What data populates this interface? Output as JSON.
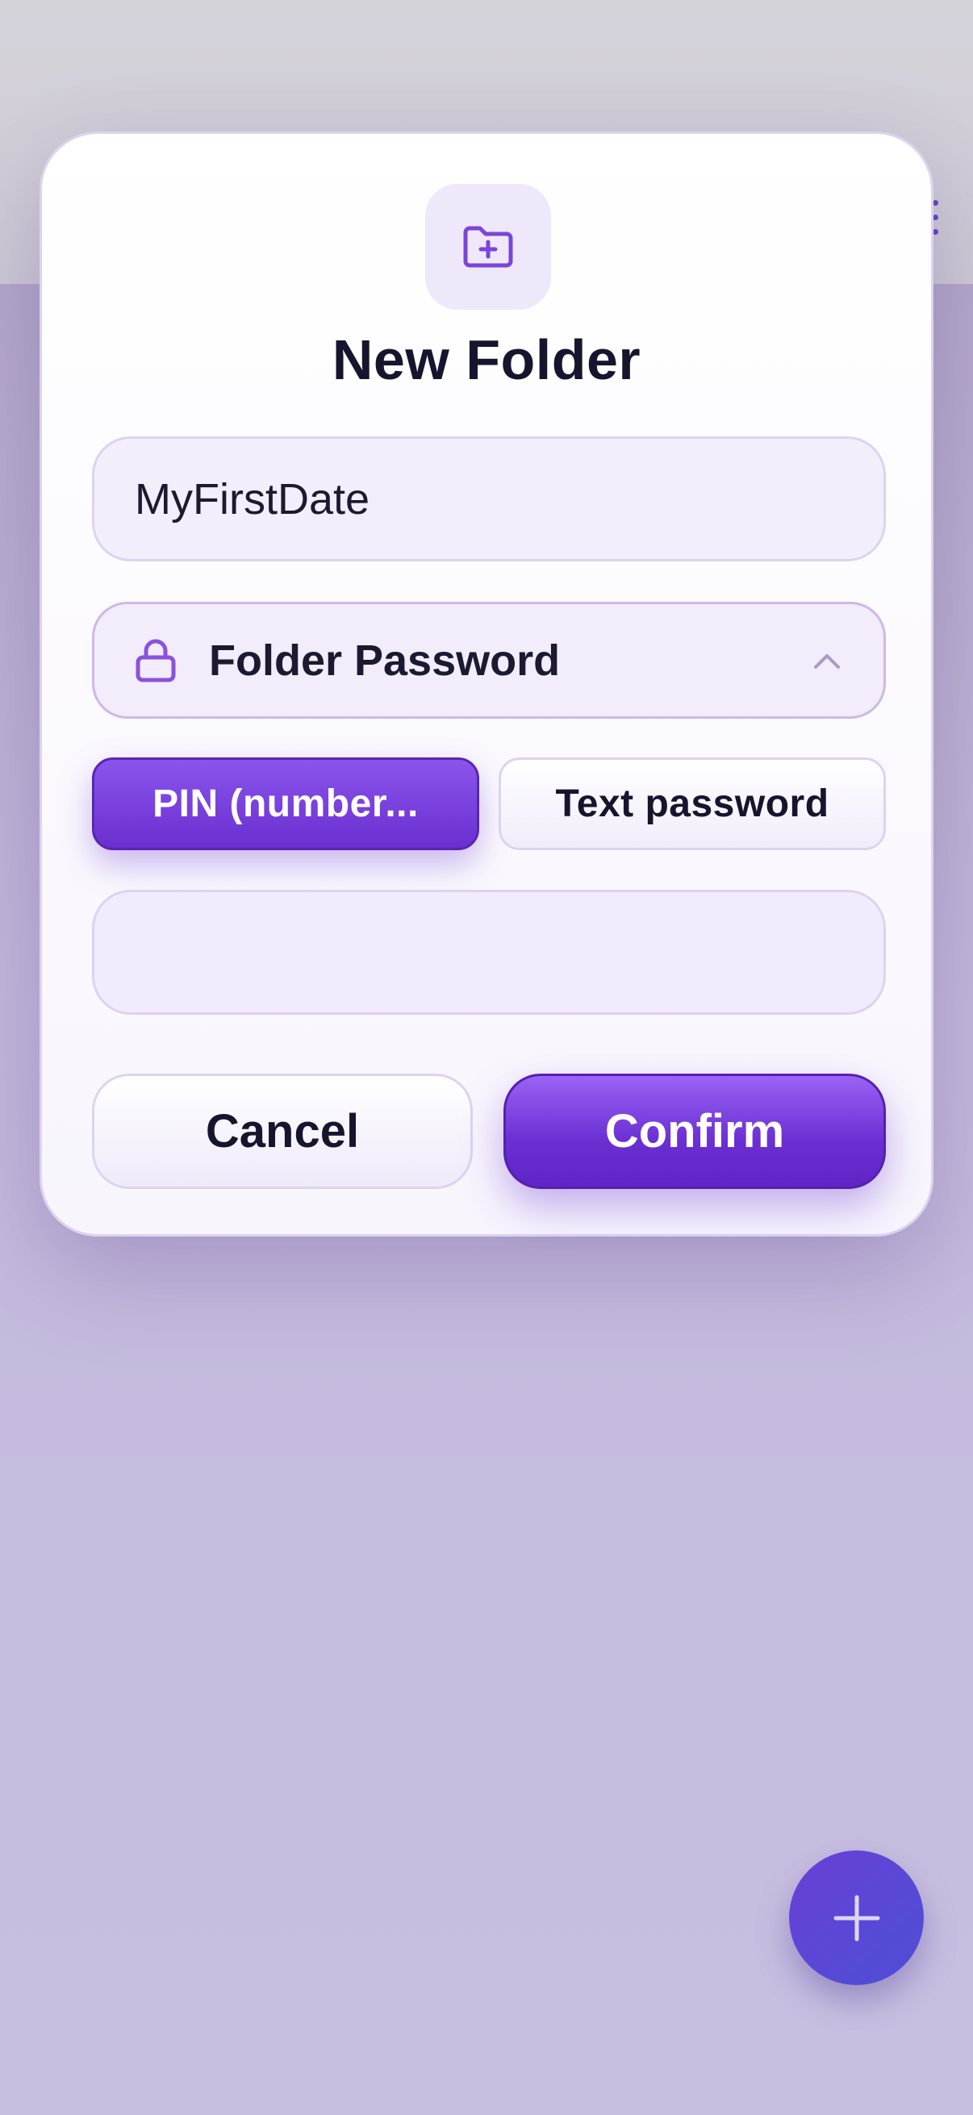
{
  "dialog": {
    "title": "New Folder",
    "folder_name_value": "MyFirstDate",
    "password_section_label": "Folder Password",
    "password_mode_options": [
      {
        "label": "PIN (number...",
        "selected": true
      },
      {
        "label": "Text password",
        "selected": false
      }
    ],
    "password_value": "",
    "cancel_label": "Cancel",
    "confirm_label": "Confirm"
  },
  "icons": {
    "dialog_badge": "folder-plus-icon",
    "password_section": "lock-icon",
    "password_section_toggle": "chevron-up-icon",
    "background_menu": "kebab-menu-icon",
    "fab": "plus-icon"
  },
  "colors": {
    "accent": "#6a2ed2",
    "accent_light": "#9a63f5",
    "title_text": "#17142e",
    "fab": "#5a47d6"
  }
}
